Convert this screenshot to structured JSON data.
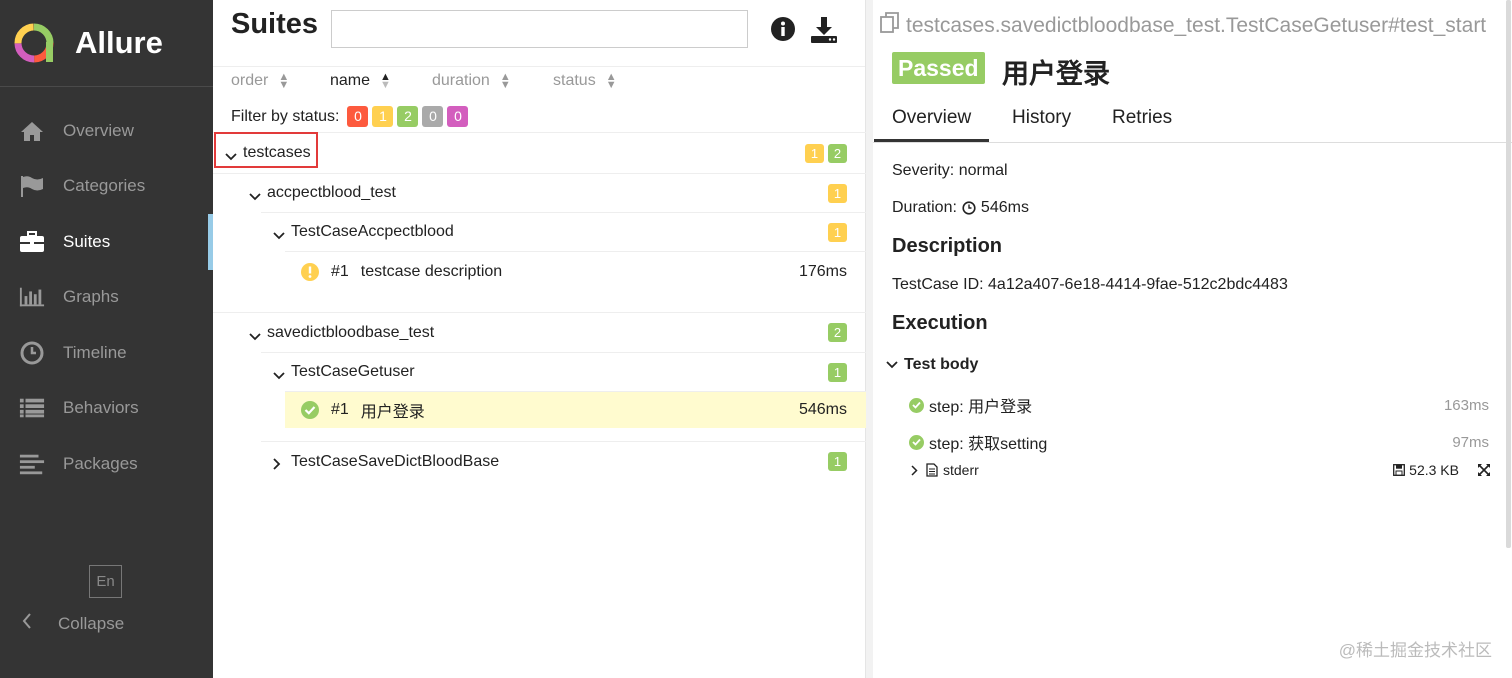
{
  "sidebar": {
    "brand": "Allure",
    "items": [
      {
        "label": "Overview",
        "icon": "home-icon"
      },
      {
        "label": "Categories",
        "icon": "flag-icon"
      },
      {
        "label": "Suites",
        "icon": "briefcase-icon",
        "active": true
      },
      {
        "label": "Graphs",
        "icon": "bar-chart-icon"
      },
      {
        "label": "Timeline",
        "icon": "clock-icon"
      },
      {
        "label": "Behaviors",
        "icon": "list-icon"
      },
      {
        "label": "Packages",
        "icon": "align-left-icon"
      }
    ],
    "lang": "En",
    "collapse_label": "Collapse"
  },
  "suites": {
    "title": "Suites",
    "search_value": "",
    "sort": {
      "order": "order",
      "name": "name",
      "duration": "duration",
      "status": "status",
      "active": "name"
    },
    "filter_label": "Filter by status:",
    "filter_counts": {
      "failed": "0",
      "broken": "1",
      "passed": "2",
      "skipped": "0",
      "unknown": "0"
    },
    "tree": {
      "root": {
        "label": "testcases",
        "broken": "1",
        "passed": "2"
      },
      "suite1": {
        "label": "accpectblood_test",
        "broken": "1"
      },
      "class1": {
        "label": "TestCaseAccpectblood",
        "broken": "1"
      },
      "case1": {
        "num": "#1",
        "label": "testcase description",
        "duration": "176ms"
      },
      "suite2": {
        "label": "savedictbloodbase_test",
        "passed": "2"
      },
      "class2": {
        "label": "TestCaseGetuser",
        "passed": "1"
      },
      "case2": {
        "num": "#1",
        "label": "用户登录",
        "duration": "546ms"
      },
      "class3": {
        "label": "TestCaseSaveDictBloodBase",
        "passed": "1"
      }
    }
  },
  "detail": {
    "path": "testcases.savedictbloodbase_test.TestCaseGetuser#test_start",
    "status": "Passed",
    "title": "用户登录",
    "tabs": {
      "overview": "Overview",
      "history": "History",
      "retries": "Retries"
    },
    "severity": "Severity: normal",
    "duration_label": "Duration:",
    "duration_value": "546ms",
    "description_heading": "Description",
    "description": "TestCase ID: 4a12a407-6e18-4414-9fae-512c2bdc4483",
    "execution_heading": "Execution",
    "test_body_label": "Test body",
    "steps": [
      {
        "label": "step: 用户登录",
        "time": "163ms"
      },
      {
        "label": "step: 获取setting",
        "time": "97ms"
      }
    ],
    "attachment": {
      "name": "stderr",
      "size": "52.3 KB"
    }
  },
  "watermark": "@稀土掘金技术社区",
  "colors": {
    "passed": "#97cc64",
    "broken": "#ffd050",
    "failed": "#fd5a3e",
    "skipped": "#aaaaaa",
    "unknown": "#d35ebe",
    "sidebar": "#343434",
    "active_bar": "#97cbe7"
  }
}
